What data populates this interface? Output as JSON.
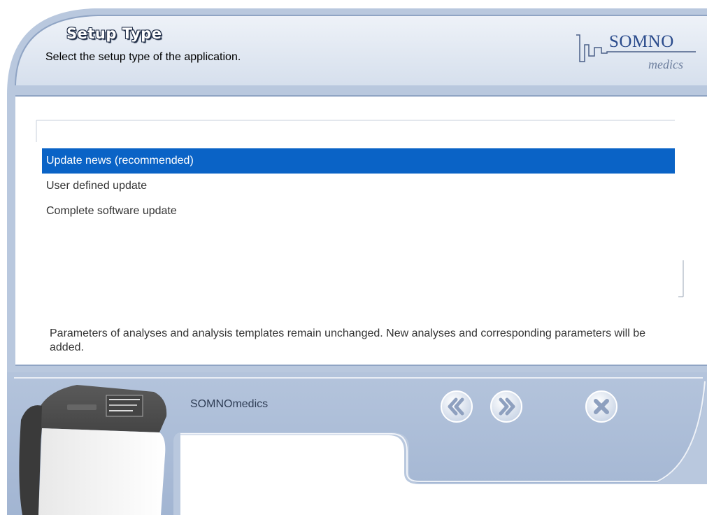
{
  "header": {
    "title": "Setup Type",
    "subtitle": "Select the setup type of the application."
  },
  "logo": {
    "line1": "SOMNO",
    "line2": "medics"
  },
  "options": [
    {
      "label": "Update news (recommended)",
      "selected": true
    },
    {
      "label": "User defined update",
      "selected": false
    },
    {
      "label": "Complete software update",
      "selected": false
    }
  ],
  "description": "Parameters of analyses and analysis templates remain unchanged. New analyses and corresponding parameters will be added.",
  "footer": {
    "brand": "SOMNOmedics"
  },
  "nav": {
    "back_icon": "double-chevron-left-icon",
    "next_icon": "double-chevron-right-icon",
    "close_icon": "close-x-icon"
  },
  "colors": {
    "selection": "#0a63c6",
    "frame": "#9db0cd",
    "header_bg": "#dce4f0",
    "logo_text": "#2a4b8c"
  }
}
